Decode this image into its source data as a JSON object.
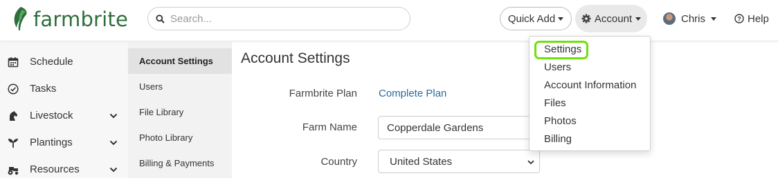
{
  "header": {
    "logo_text": "farmbrite",
    "search_placeholder": "Search...",
    "quick_add_label": "Quick Add",
    "account_label": "Account",
    "user_name": "Chris",
    "help_label": "Help"
  },
  "sidebar": {
    "items": [
      {
        "label": "Schedule",
        "icon": "calendar-icon"
      },
      {
        "label": "Tasks",
        "icon": "check-circle-icon"
      },
      {
        "label": "Livestock",
        "icon": "horse-icon"
      },
      {
        "label": "Plantings",
        "icon": "seedling-icon"
      },
      {
        "label": "Resources",
        "icon": "tractor-icon"
      }
    ]
  },
  "subnav": {
    "items": [
      "Account Settings",
      "Users",
      "File Library",
      "Photo Library",
      "Billing & Payments"
    ],
    "active": "Account Settings"
  },
  "main": {
    "title": "Account Settings",
    "plan_label": "Farmbrite Plan",
    "plan_value": "Complete Plan",
    "farm_name_label": "Farm Name",
    "farm_name_value": "Copperdale Gardens",
    "country_label": "Country",
    "country_value": "United States"
  },
  "account_menu": {
    "items": [
      "Settings",
      "Users",
      "Account Information",
      "Files",
      "Photos",
      "Billing"
    ],
    "highlighted": "Settings",
    "highlight_color": "#6ee00b"
  },
  "colors": {
    "brand_green": "#2d6f3c",
    "link_blue": "#2a6a9a"
  }
}
